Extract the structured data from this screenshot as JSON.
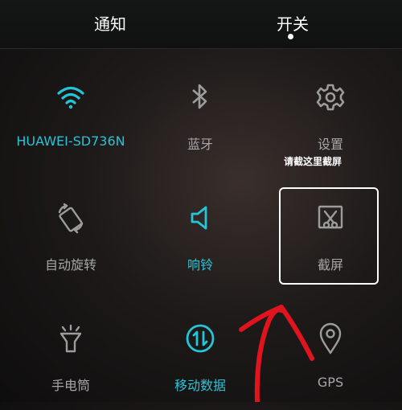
{
  "tabs": {
    "notify_label": "通知",
    "switch_label": "开关"
  },
  "tiles": [
    {
      "label": "HUAWEI-SD736N",
      "icon": "wifi-icon",
      "active": true
    },
    {
      "label": "蓝牙",
      "icon": "bluetooth-icon",
      "active": false
    },
    {
      "label": "设置",
      "icon": "gear-icon",
      "active": false
    },
    {
      "label": "自动旋转",
      "icon": "auto-rotate-icon",
      "active": false
    },
    {
      "label": "响铃",
      "icon": "speaker-icon",
      "active": true
    },
    {
      "label": "截屏",
      "icon": "screenshot-icon",
      "active": false
    },
    {
      "label": "手电筒",
      "icon": "flashlight-icon",
      "active": false
    },
    {
      "label": "移动数据",
      "icon": "mobile-data-icon",
      "active": true
    },
    {
      "label": "GPS",
      "icon": "location-pin-icon",
      "active": false
    }
  ],
  "annotation": {
    "hint_text": "请截这里截屏",
    "arrow_color": "#e0141e",
    "box_color": "#ffffff"
  },
  "colors": {
    "accent": "#27c4d8",
    "inactive_text": "#a7a7a7",
    "inactive_icon": "#9c9c9c"
  }
}
